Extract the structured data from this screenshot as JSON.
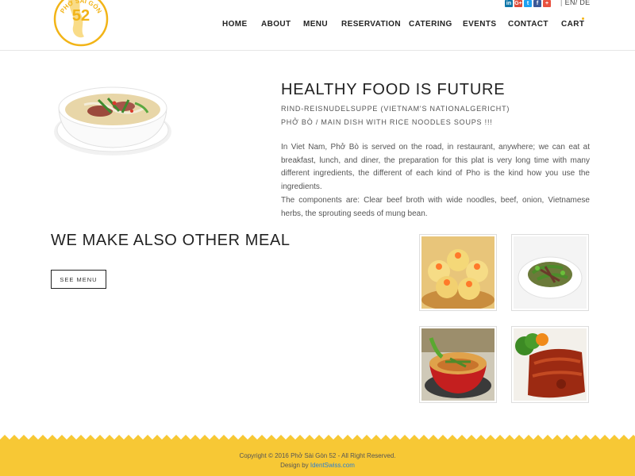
{
  "header": {
    "logo_text": "PHỞ SÀI GÒN",
    "logo_number": "52",
    "social_icons": [
      "linkedin-icon",
      "google-plus-icon",
      "twitter-icon",
      "facebook-icon",
      "plus-icon"
    ],
    "social_glyphs": [
      "in",
      "G+",
      "t",
      "f",
      "+"
    ],
    "language": {
      "separator": "|",
      "en": "EN/",
      "de": "DE"
    },
    "nav": [
      "HOME",
      "ABOUT",
      "MENU",
      "RESERVATION",
      "CATERING",
      "EVENTS",
      "CONTACT",
      "CART"
    ]
  },
  "intro": {
    "title": "HEALTHY FOOD IS FUTURE",
    "subtitle1": "RIND-REISNUDELSUPPE (VIETNAM'S NATIONALGERICHT)",
    "subtitle2": "PHỞ BÒ / MAIN DISH WITH RICE NOODLES SOUPS !!!",
    "paragraph1": "In Viet Nam, Phở Bò is served on the road, in restaurant, anywhere; we can eat at breakfast, lunch, and diner, the preparation for this plat is very long time with many different ingredients, the different of each kind of Pho is the kind how you use the ingredients.",
    "paragraph2": "The components are: Clear beef broth with wide noodles, beef, onion, Vietnamese herbs, the sprouting seeds of mung bean."
  },
  "other_meals": {
    "title": "WE MAKE ALSO OTHER MEAL",
    "button": "SEE MENU"
  },
  "footer": {
    "copyright": "Copyright © 2016 Phở Sài Gòn 52 - All Right Reserved.",
    "design_prefix": "Design by ",
    "design_link": "IdentSwiss.com"
  },
  "colors": {
    "accent": "#f7c835",
    "footer_bg": "#f7c835",
    "link": "#2a7fd4",
    "linkedin": "#0e76a8",
    "google": "#dd4b39",
    "twitter": "#1da1f2",
    "facebook": "#3b5998",
    "plus": "#e8513f"
  }
}
